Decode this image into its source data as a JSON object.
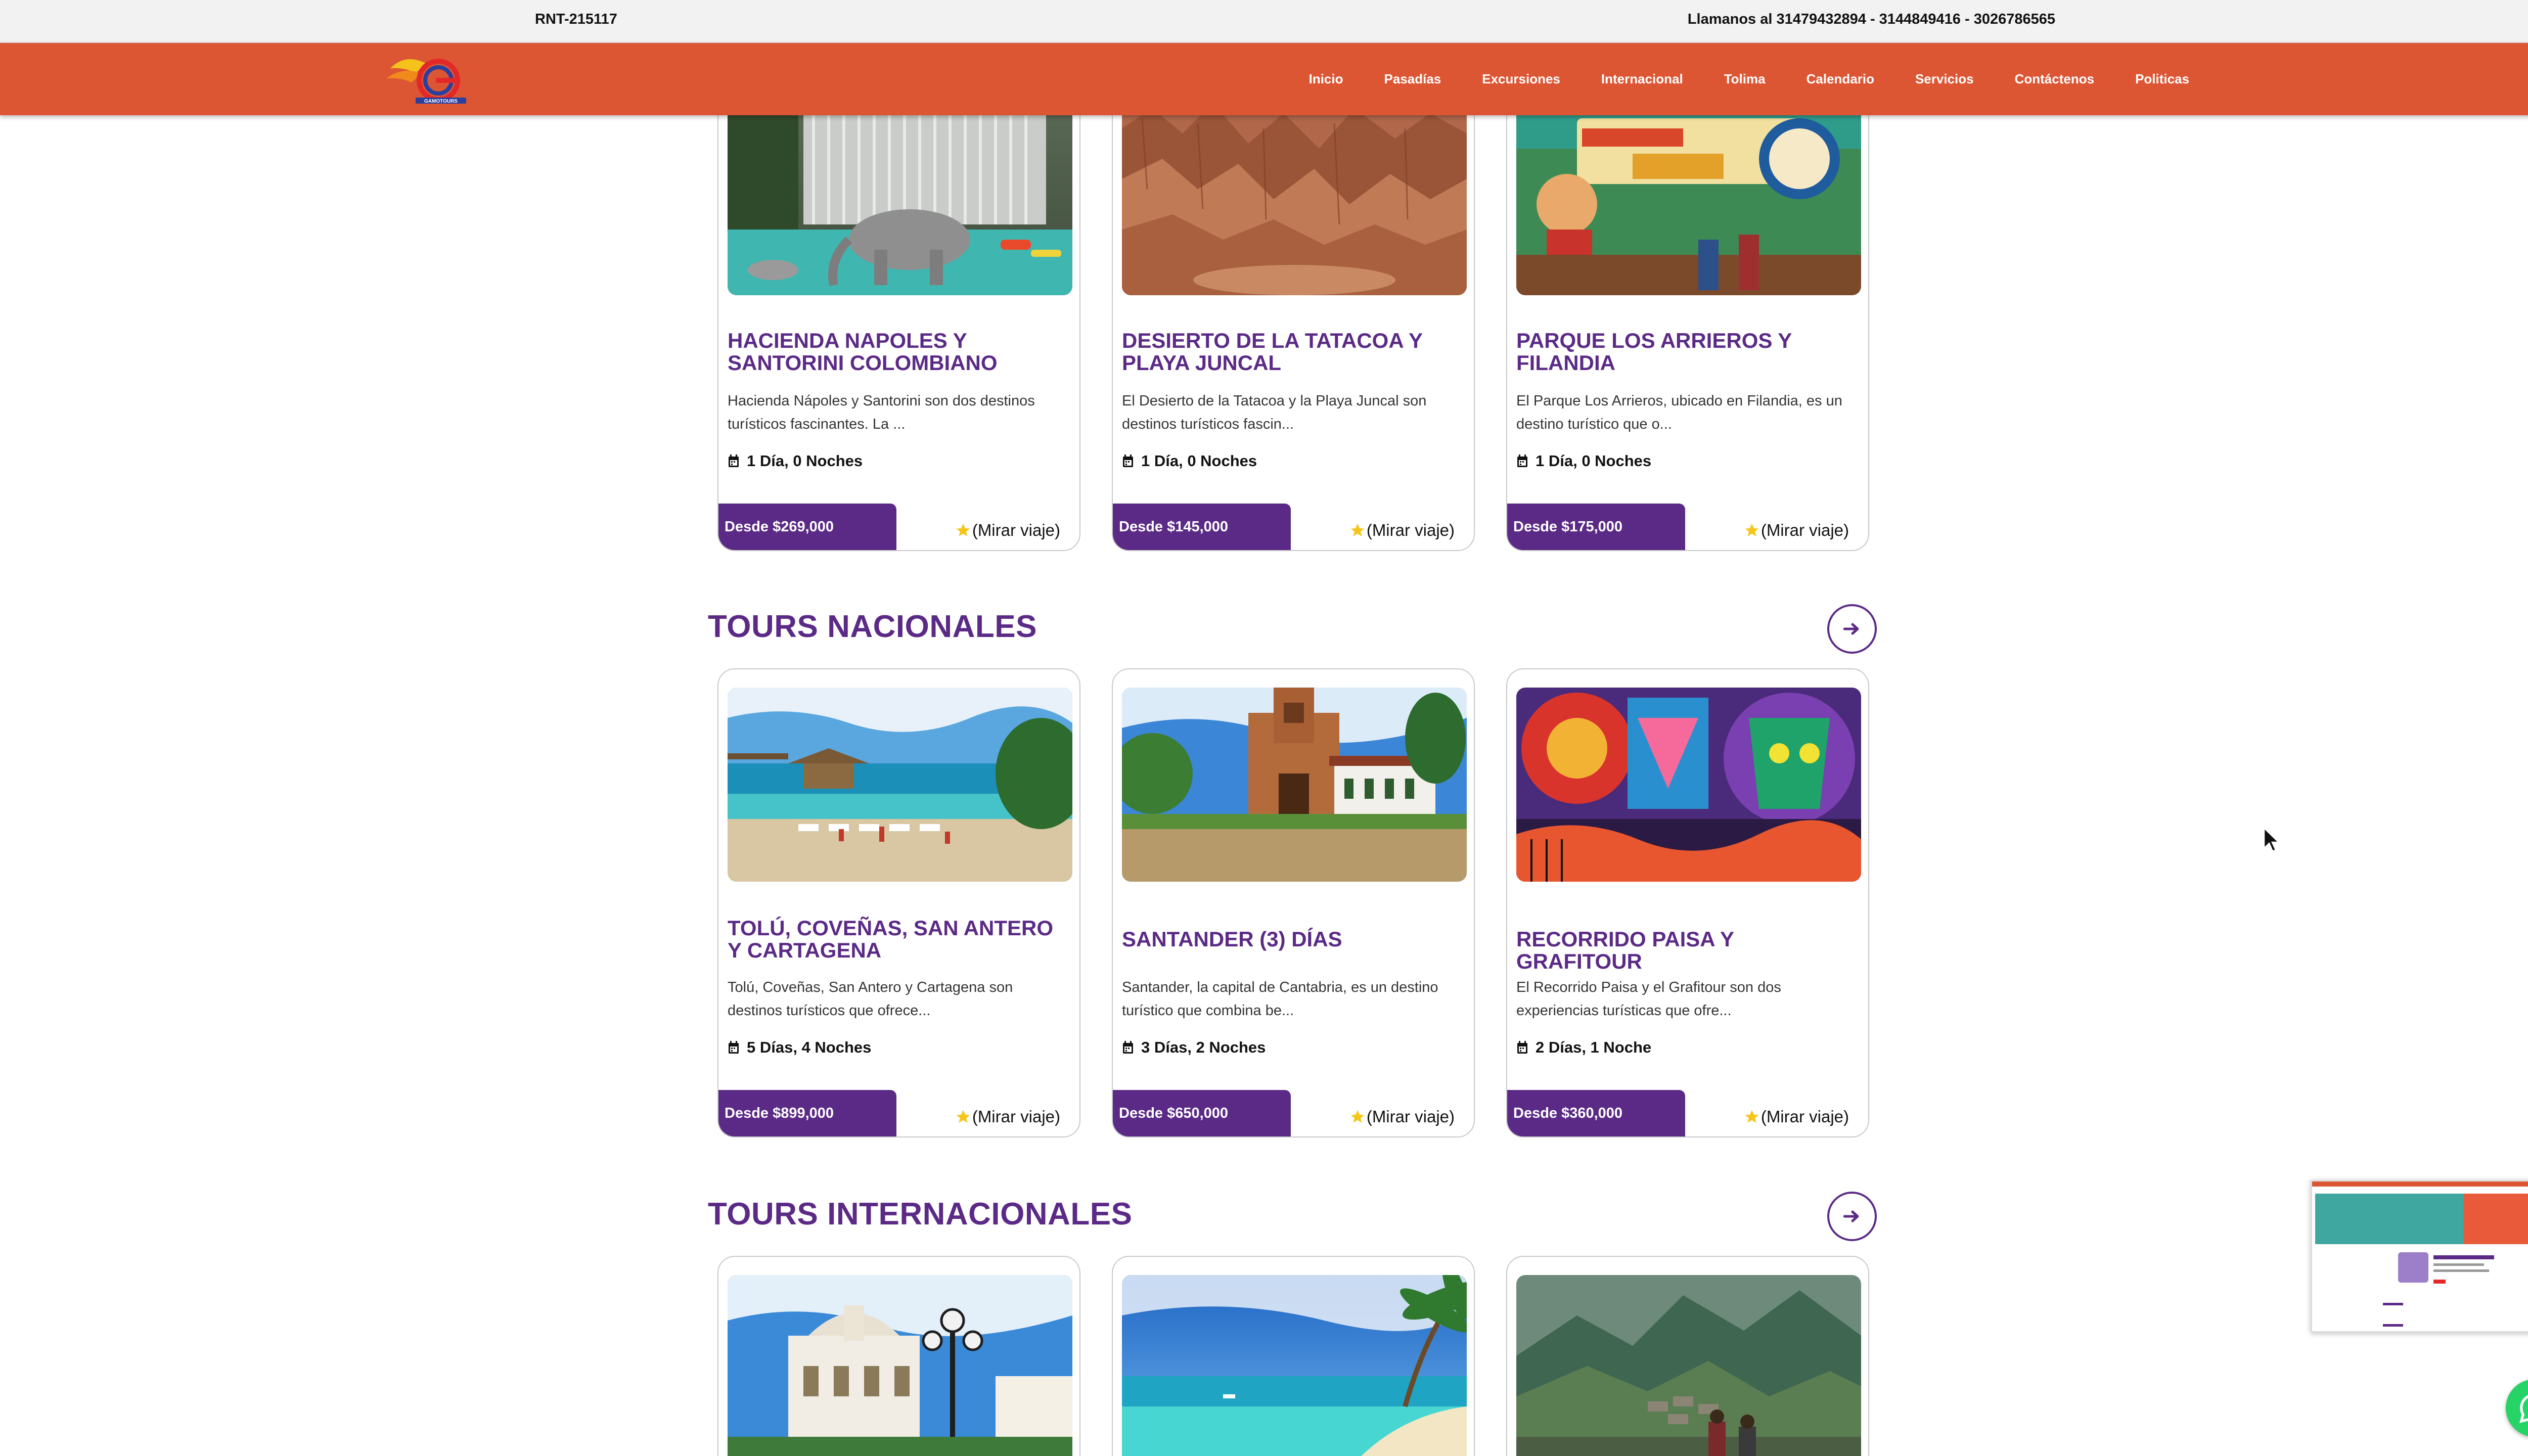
{
  "topbar": {
    "rnt": "RNT-215117",
    "phones": "Llamanos al 31479432894 - 3144849416 - 3026786565"
  },
  "brand": {
    "logo_text": "GAMOTOURS"
  },
  "nav": [
    {
      "label": "Inicio"
    },
    {
      "label": "Pasadías"
    },
    {
      "label": "Excursiones"
    },
    {
      "label": "Internacional"
    },
    {
      "label": "Tolima"
    },
    {
      "label": "Calendario"
    },
    {
      "label": "Servicios"
    },
    {
      "label": "Contáctenos"
    },
    {
      "label": "Politicas"
    }
  ],
  "excursiones": {
    "cards": [
      {
        "title": "HACIENDA NAPOLES Y SANTORINI COLOMBIANO",
        "desc": "Hacienda Nápoles y Santorini son dos destinos turísticos fascinantes. La ...",
        "duration": "1 Día, 0 Noches",
        "price": "Desde $269,000",
        "link": "(Mirar viaje)"
      },
      {
        "title": "DESIERTO DE LA TATACOA Y PLAYA JUNCAL",
        "desc": "El Desierto de la Tatacoa y la Playa Juncal son destinos turísticos fascin...",
        "duration": "1 Día, 0 Noches",
        "price": "Desde $145,000",
        "link": "(Mirar viaje)"
      },
      {
        "title": "PARQUE LOS ARRIEROS Y FILANDIA",
        "desc": "El Parque Los Arrieros, ubicado en Filandia, es un destino turístico que o...",
        "duration": "1 Día, 0 Noches",
        "price": "Desde $175,000",
        "link": "(Mirar viaje)"
      }
    ]
  },
  "nacionales": {
    "title": "TOURS NACIONALES",
    "cards": [
      {
        "title": "TOLÚ, COVEÑAS, SAN ANTERO Y CARTAGENA",
        "desc": "Tolú, Coveñas, San Antero y Cartagena son destinos turísticos que ofrece...",
        "duration": "5 Días, 4 Noches",
        "price": "Desde $899,000",
        "link": "(Mirar viaje)"
      },
      {
        "title": "SANTANDER (3) DÍAS",
        "desc": "Santander, la capital de Cantabria, es un destino turístico que combina be...",
        "duration": "3 Días, 2 Noches",
        "price": "Desde $650,000",
        "link": "(Mirar viaje)"
      },
      {
        "title": "RECORRIDO PAISA Y GRAFITOUR",
        "desc": "El Recorrido Paisa y el Grafitour son dos experiencias turísticas que ofre...",
        "duration": "2 Días, 1 Noche",
        "price": "Desde $360,000",
        "link": "(Mirar viaje)"
      }
    ]
  },
  "internacionales": {
    "title": "TOURS INTERNACIONALES"
  },
  "icons": {
    "calendar": "calendar-icon",
    "star": "star-icon",
    "arrow": "arrow-right-icon",
    "whatsapp": "whatsapp-icon"
  },
  "colors": {
    "accent": "#dc5634",
    "brand_purple": "#5b2a86",
    "star": "#f5c518",
    "whatsapp": "#25d366"
  }
}
